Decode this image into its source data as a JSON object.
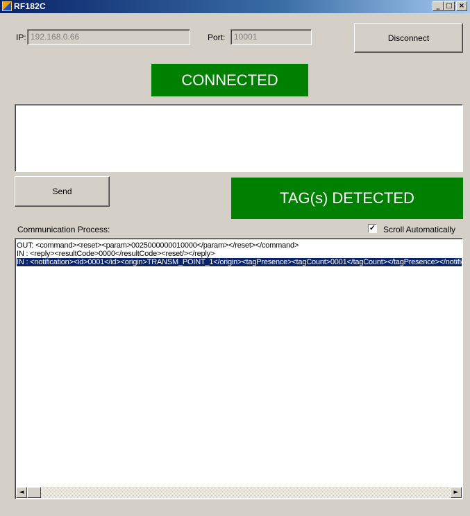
{
  "window": {
    "title": "RF182C",
    "minimize_glyph": "_",
    "maximize_glyph": "□",
    "close_glyph": "×"
  },
  "connection": {
    "ip_label": "IP:",
    "ip_value": "192.168.0.66",
    "port_label": "Port:",
    "port_value": "10001",
    "disconnect_label": "Disconnect"
  },
  "status": {
    "connection_text": "CONNECTED",
    "tag_text": "TAG(s) DETECTED",
    "color": "#008000"
  },
  "command": {
    "input_value": "",
    "send_label": "Send"
  },
  "communication": {
    "label": "Communication Process:",
    "scroll_auto_label": "Scroll Automatically",
    "scroll_auto_checked": true,
    "log_lines": [
      "OUT: <command><reset><param>0025000000010000</param></reset></command>",
      "IN : <reply><resultCode>0000</resultCode><reset/></reply>",
      "IN : <notification><id>0001</id><origin>TRANSM_POINT_1</origin><tagPresence><tagCount>0001</tagCount></tagPresence></notification>"
    ],
    "selected_line_index": 2
  },
  "scrollbar": {
    "left_arrow": "◄",
    "right_arrow": "►"
  }
}
